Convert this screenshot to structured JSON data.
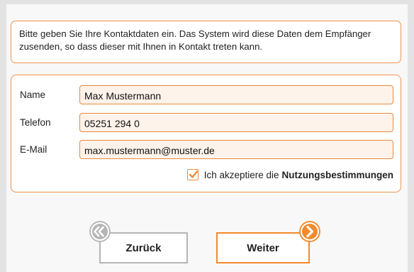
{
  "intro": {
    "text": "Bitte geben Sie Ihre Kontaktdaten ein. Das System wird diese Daten dem Empfänger zusenden, so dass dieser mit Ihnen in Kontakt treten kann."
  },
  "form": {
    "name": {
      "label": "Name",
      "value": "Max Mustermann"
    },
    "phone": {
      "label": "Telefon",
      "value": "05251 294 0"
    },
    "email": {
      "label": "E-Mail",
      "value": "max.mustermann@muster.de"
    },
    "terms": {
      "checked": true,
      "prefix": "Ich akzeptiere die",
      "link": "Nutzungsbestimmungen"
    }
  },
  "nav": {
    "back_label": "Zurück",
    "next_label": "Weiter"
  },
  "colors": {
    "accent": "#f28a2d",
    "field_bg": "#fdf3ea",
    "back_icon": "#b5b5b5"
  },
  "icons": {
    "back": "chevron-left-icon",
    "next": "chevron-right-icon",
    "check": "checkmark-icon"
  }
}
